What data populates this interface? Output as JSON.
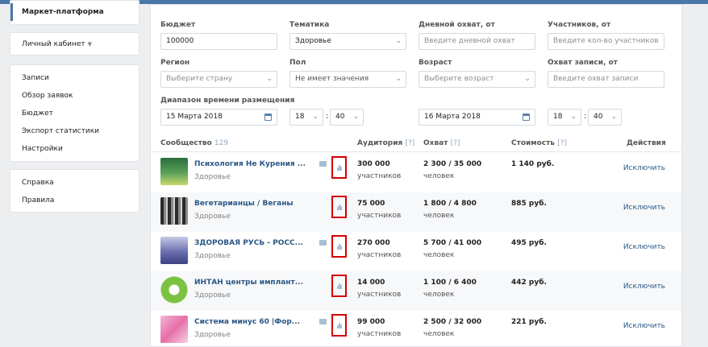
{
  "sidebar": {
    "market": "Маркет-платформа",
    "cabinet": "Личный кабинет",
    "menu": [
      "Записи",
      "Обзор заявок",
      "Бюджет",
      "Экспорт статистики",
      "Настройки"
    ],
    "help": [
      "Справка",
      "Правила"
    ]
  },
  "filters": {
    "budget_label": "Бюджет",
    "budget_value": "100000",
    "topic_label": "Тематика",
    "topic_value": "Здоровье",
    "daily_reach_label": "Дневной охват, от",
    "daily_reach_placeholder": "Введите дневной охват",
    "members_label": "Участников, от",
    "members_placeholder": "Введите кол-во участников",
    "region_label": "Регион",
    "region_placeholder": "Выберите страну",
    "gender_label": "Пол",
    "gender_value": "Не имеет значения",
    "age_label": "Возраст",
    "age_placeholder": "Выберите возраст",
    "post_reach_label": "Охват записи, от",
    "post_reach_placeholder": "Введите охват записи",
    "period_label": "Диапазон времени размещения",
    "date_from": "15 Марта 2018",
    "hour_from": "18",
    "min_from": "40",
    "date_to": "16 Марта 2018",
    "hour_to": "18",
    "min_to": "40",
    "colon": ":"
  },
  "table": {
    "col_community": "Сообщество",
    "community_count": "129",
    "col_audience": "Аудитория",
    "col_reach": "Охват",
    "col_cost": "Стоимость",
    "col_actions": "Действия",
    "help_mark": "[?]",
    "rows": [
      {
        "name": "Психология Не Курения ...",
        "topic": "Здоровье",
        "audience": "300 000",
        "audience_unit": "участников",
        "reach": "2 300 / 35 000",
        "reach_unit": "человек",
        "cost": "1 140 руб.",
        "action": "Исключить"
      },
      {
        "name": "Вегетарианцы / Веганы",
        "topic": "Здоровье",
        "audience": "75 000",
        "audience_unit": "участников",
        "reach": "1 800 / 4 800",
        "reach_unit": "человек",
        "cost": "885 руб.",
        "action": "Исключить"
      },
      {
        "name": "ЗДОРОВАЯ РУСЬ - РОСС...",
        "topic": "Здоровье",
        "audience": "270 000",
        "audience_unit": "участников",
        "reach": "5 700 / 41 000",
        "reach_unit": "человек",
        "cost": "495 руб.",
        "action": "Исключить"
      },
      {
        "name": "ИНТАН центры имплант...",
        "topic": "Здоровье",
        "audience": "14 000",
        "audience_unit": "участников",
        "reach": "1 100 / 6 400",
        "reach_unit": "человек",
        "cost": "442 руб.",
        "action": "Исключить"
      },
      {
        "name": "Система минус 60 |Фор...",
        "topic": "Здоровье",
        "audience": "99 000",
        "audience_unit": "участников",
        "reach": "2 500 / 32 000",
        "reach_unit": "человек",
        "cost": "221 руб.",
        "action": "Исключить"
      }
    ]
  },
  "colors": {
    "accent": "#4a76a8",
    "link": "#2a5885",
    "highlight": "#d30000"
  }
}
